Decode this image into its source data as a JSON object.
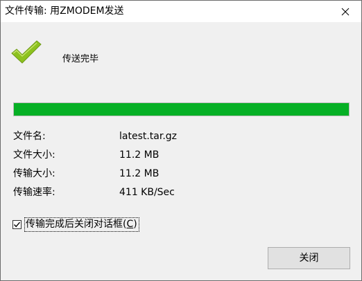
{
  "window": {
    "title": "文件传输: 用ZMODEM发送"
  },
  "status": {
    "text": "传送完毕"
  },
  "progress": {
    "percent": 100,
    "fill_color": "#06b025"
  },
  "info": [
    {
      "label": "文件名:",
      "value": "latest.tar.gz"
    },
    {
      "label": "文件大小:",
      "value": "11.2 MB"
    },
    {
      "label": "传输大小:",
      "value": "11.2 MB"
    },
    {
      "label": "传输速率:",
      "value": "411 KB/Sec"
    }
  ],
  "option": {
    "label_prefix": "传输完成后关闭对话框(",
    "accelerator": "C",
    "label_suffix": ")",
    "checked": true
  },
  "buttons": {
    "close_label": "关闭"
  },
  "icons": {
    "titlebar_close": "close-icon",
    "status": "checkmark-icon"
  },
  "colors": {
    "checkmark": "#8dc21f",
    "progress": "#06b025"
  }
}
